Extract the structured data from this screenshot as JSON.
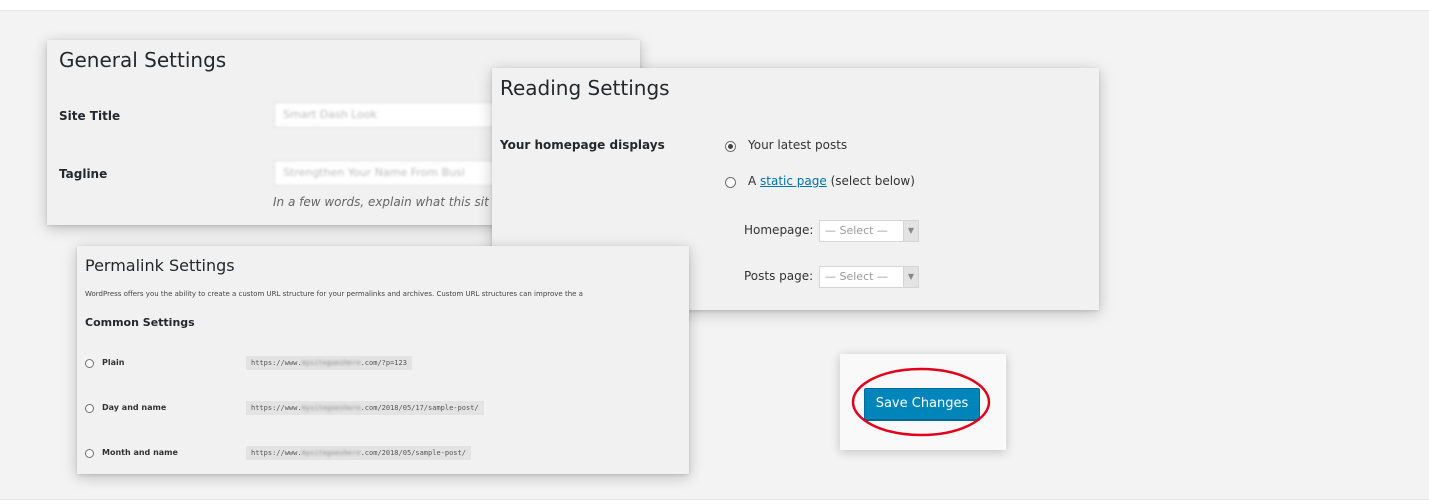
{
  "general": {
    "title": "General Settings",
    "site_title_label": "Site Title",
    "site_title_value": "Smart Dash Look",
    "tagline_label": "Tagline",
    "tagline_value": "Strengthen Your Name From Busi",
    "tagline_hint": "In a few words, explain what this sit"
  },
  "reading": {
    "title": "Reading Settings",
    "homepage_displays_label": "Your homepage displays",
    "option_latest": "Your latest posts",
    "option_static_prefix": "A ",
    "option_static_link": "static page",
    "option_static_suffix": " (select below)",
    "homepage_label": "Homepage:",
    "posts_page_label": "Posts page:",
    "select_placeholder": "— Select —"
  },
  "permalink": {
    "title": "Permalink Settings",
    "description": "WordPress offers you the ability to create a custom URL structure for your permalinks and archives. Custom URL structures can improve the a",
    "common_settings": "Common Settings",
    "options": [
      {
        "label": "Plain",
        "url_prefix": "https://www.",
        "url_blur": "mysitegoeshere",
        "url_suffix": ".com/?p=123"
      },
      {
        "label": "Day and name",
        "url_prefix": "https://www.",
        "url_blur": "mysitegoeshere",
        "url_suffix": ".com/2018/05/17/sample-post/"
      },
      {
        "label": "Month and name",
        "url_prefix": "https://www.",
        "url_blur": "mysitegoeshere",
        "url_suffix": ".com/2018/05/sample-post/"
      }
    ]
  },
  "save": {
    "label": "Save Changes",
    "color": "#0085ba",
    "highlight_color": "#e0001b"
  }
}
